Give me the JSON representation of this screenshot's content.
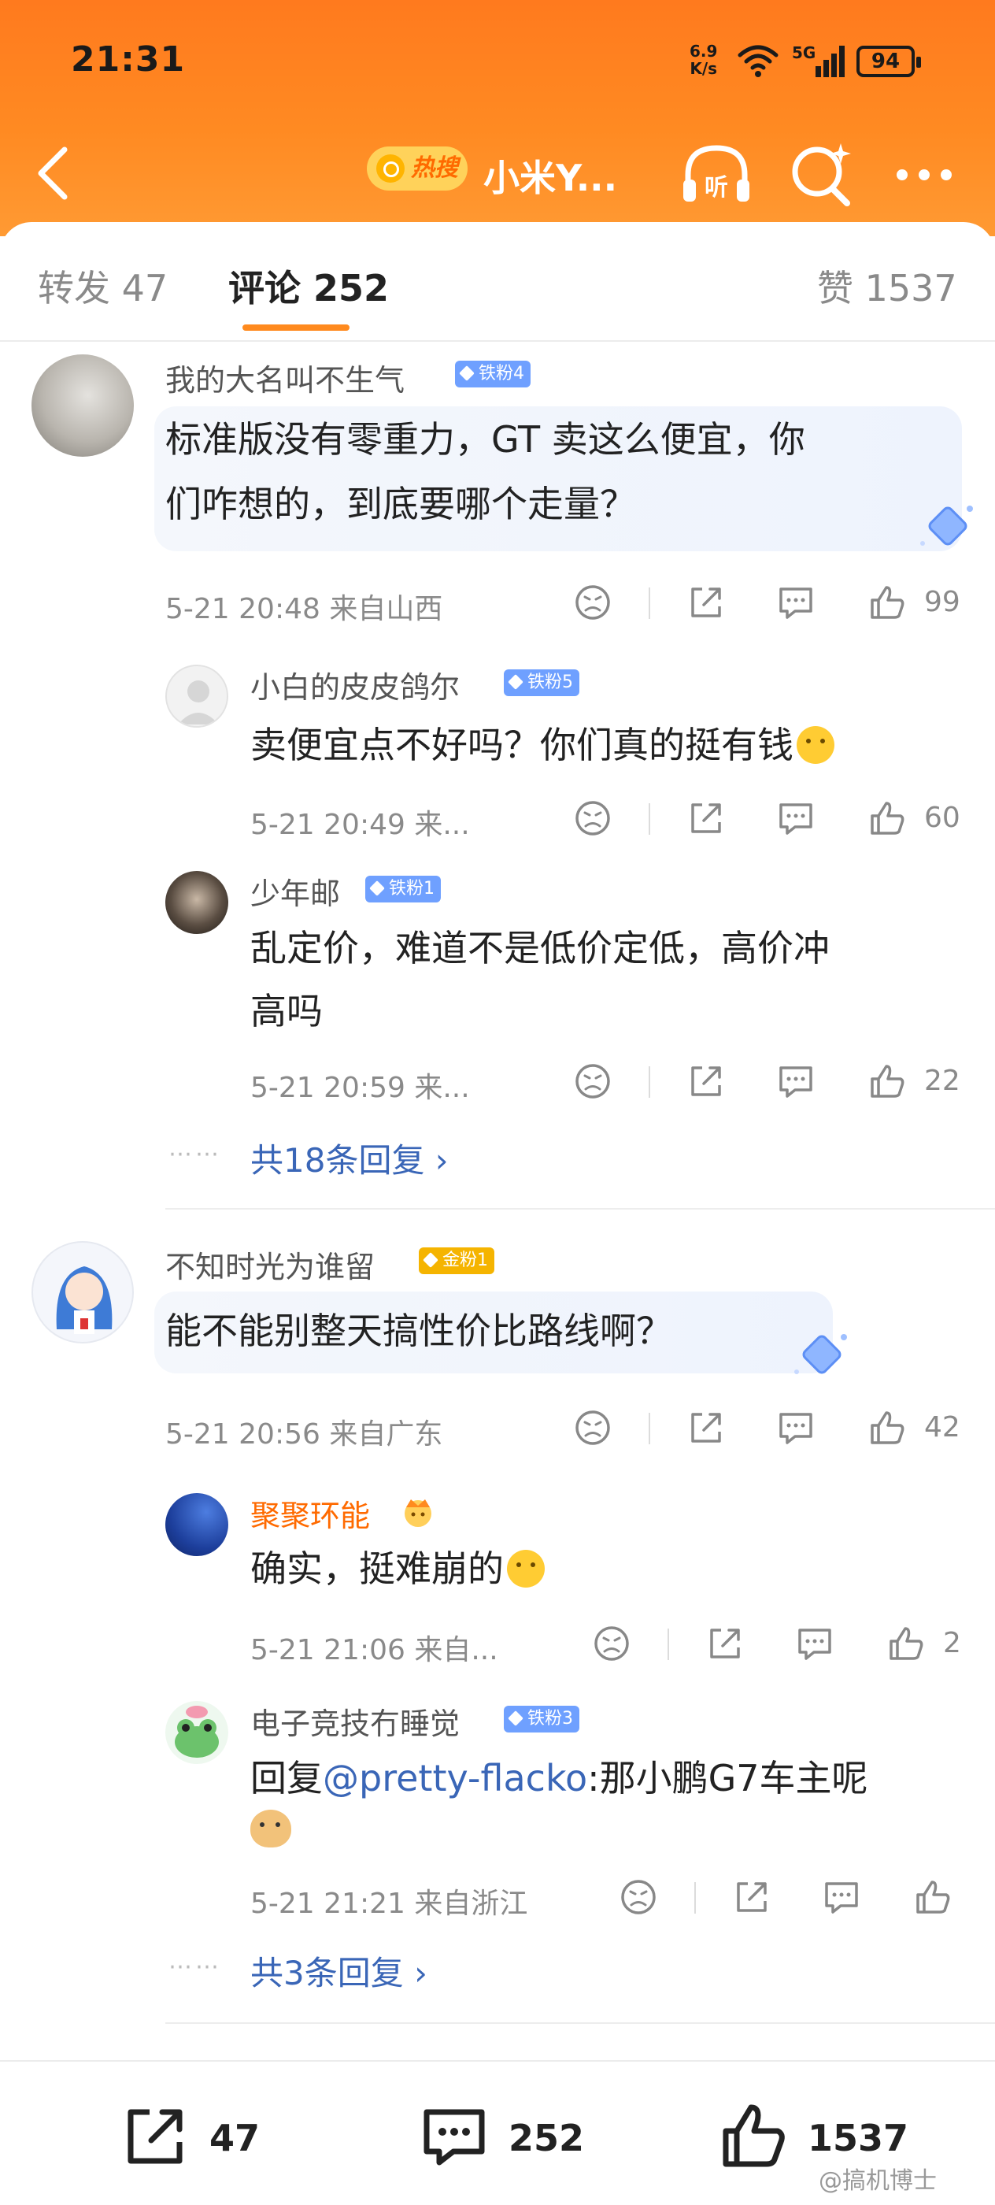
{
  "status_bar": {
    "time": "21:31",
    "net_speed_value": "6.9",
    "net_speed_unit": "K/s",
    "network_type": "5G",
    "battery": "94"
  },
  "nav": {
    "hot_label": "热搜",
    "title": "小米Y..."
  },
  "tabs": {
    "repost": "转发 47",
    "comments": "评论 252",
    "likes": "赞 1537"
  },
  "comments": [
    {
      "user": "我的大名叫不生气",
      "badge": "铁粉4",
      "text_line1": "标准版没有零重力，GT 卖这么便宜，你",
      "text_line2": "们咋想的，到底要哪个走量？",
      "meta": "5-21 20:48 来自山西",
      "likes": "99",
      "replies": [
        {
          "user": "小白的皮皮鸽尔",
          "badge": "铁粉5",
          "text": "卖便宜点不好吗？你们真的挺有钱",
          "meta": "5-21 20:49 来...",
          "likes": "60"
        },
        {
          "user": "少年邮",
          "badge": "铁粉1",
          "text_line1": "乱定价，难道不是低价定低，高价冲",
          "text_line2": "高吗",
          "meta": "5-21 20:59 来...",
          "likes": "22"
        }
      ],
      "more_replies": "共18条回复"
    },
    {
      "user": "不知时光为谁留",
      "badge": "金粉1",
      "text": "能不能别整天搞性价比路线啊？",
      "meta": "5-21 20:56 来自广东",
      "likes": "42",
      "replies": [
        {
          "user": "聚聚环能",
          "text": "确实，挺难崩的",
          "meta": "5-21 21:06 来自...",
          "likes": "2"
        },
        {
          "user": "电子竞技冇睡觉",
          "badge": "铁粉3",
          "text_prefix": "回复",
          "mention": "@pretty-flacko",
          "text_suffix": ":那小鹏G7车主呢",
          "meta": "5-21 21:21 来自浙江"
        }
      ],
      "more_replies": "共3条回复"
    }
  ],
  "bottom_bar": {
    "reposts": "47",
    "comments": "252",
    "likes": "1537"
  },
  "watermark": "@搞机博士",
  "colors": {
    "accent": "#ff8a1e",
    "link": "#3a66b7",
    "fan_blue": "#6fa0ff",
    "fan_gold": "#f5b400"
  }
}
